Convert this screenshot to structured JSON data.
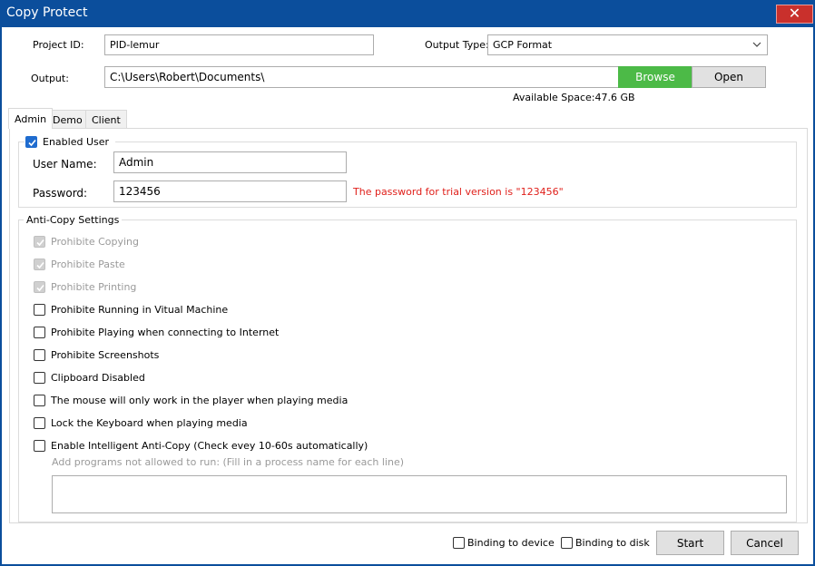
{
  "window": {
    "title": "Copy Protect",
    "close_glyph": "✕"
  },
  "form": {
    "project_id_label": "Project ID:",
    "project_id_value": "PID-lemur",
    "output_type_label": "Output Type:",
    "output_type_value": "GCP Format",
    "output_label": "Output:",
    "output_path": "C:\\Users\\Robert\\Documents\\",
    "browse_label": "Browse",
    "open_label": "Open",
    "available_space": "Available Space:47.6 GB"
  },
  "tabs": [
    {
      "label": "Admin"
    },
    {
      "label": "Demo"
    },
    {
      "label": "Client"
    }
  ],
  "admin": {
    "enabled_user_label": "Enabled User",
    "username_label": "User Name:",
    "username_value": "Admin",
    "password_label": "Password:",
    "password_value": "123456",
    "password_note": "The password for trial version is \"123456\""
  },
  "anticopy": {
    "group_label": "Anti-Copy Settings",
    "options": [
      {
        "label": "Prohibite Copying",
        "checked": true,
        "disabled": true
      },
      {
        "label": "Prohibite Paste",
        "checked": true,
        "disabled": true
      },
      {
        "label": "Prohibite Printing",
        "checked": true,
        "disabled": true
      },
      {
        "label": "Prohibite Running in Vitual Machine",
        "checked": false,
        "disabled": false
      },
      {
        "label": "Prohibite Playing when connecting to Internet",
        "checked": false,
        "disabled": false
      },
      {
        "label": "Prohibite Screenshots",
        "checked": false,
        "disabled": false
      },
      {
        "label": "Clipboard Disabled",
        "checked": false,
        "disabled": false
      },
      {
        "label": "The mouse will only work in the player when playing media",
        "checked": false,
        "disabled": false
      },
      {
        "label": "Lock the Keyboard when playing media",
        "checked": false,
        "disabled": false
      },
      {
        "label": "Enable Intelligent Anti-Copy (Check evey 10-60s automatically)",
        "checked": false,
        "disabled": false
      }
    ],
    "programs_hint": "Add programs not allowed to run: (Fill in a process name for each line)",
    "programs_value": ""
  },
  "footer": {
    "binding_device_label": "Binding to device",
    "binding_disk_label": "Binding to disk",
    "start_label": "Start",
    "cancel_label": "Cancel"
  },
  "colors": {
    "accent": "#1f6ccf",
    "titlebar": "#0b4e9c",
    "browse": "#4cba47",
    "close": "#c9302c",
    "warning": "#e0201b"
  },
  "icons": {
    "close": "close-icon",
    "dropdown": "chevron-down-icon",
    "check": "checkmark-icon"
  }
}
